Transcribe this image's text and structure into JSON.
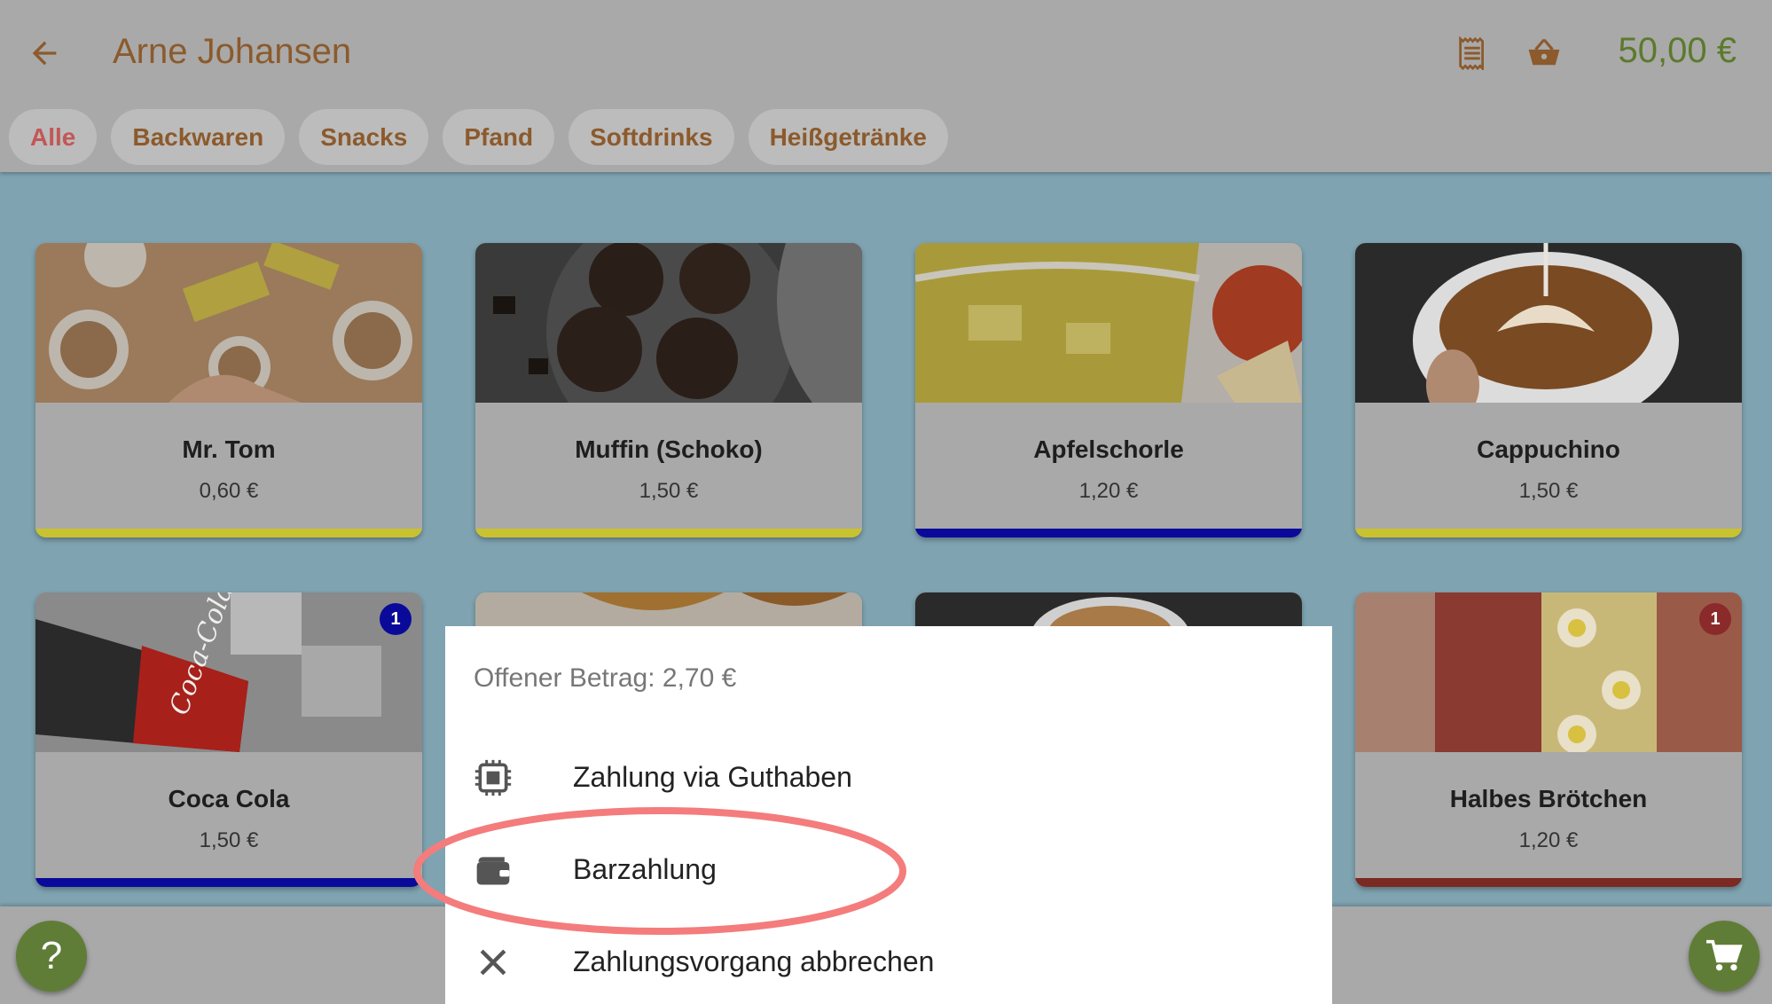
{
  "header": {
    "title": "Arne Johansen",
    "total": "50,00 €",
    "icons": {
      "back": "arrow-left-icon",
      "receipt": "receipt-icon",
      "basket": "basket-icon"
    }
  },
  "tabs": [
    {
      "label": "Alle",
      "active": true
    },
    {
      "label": "Backwaren",
      "active": false
    },
    {
      "label": "Snacks",
      "active": false
    },
    {
      "label": "Pfand",
      "active": false
    },
    {
      "label": "Softdrinks",
      "active": false
    },
    {
      "label": "Heißgetränke",
      "active": false
    }
  ],
  "products": [
    {
      "name": "Mr. Tom",
      "price": "0,60 €",
      "stripe_color": "#c9c230",
      "badge": null
    },
    {
      "name": "Muffin (Schoko)",
      "price": "1,50 €",
      "stripe_color": "#c9c230",
      "badge": null
    },
    {
      "name": "Apfelschorle",
      "price": "1,20 €",
      "stripe_color": "#0a0a9a",
      "badge": null
    },
    {
      "name": "Cappuchino",
      "price": "1,50 €",
      "stripe_color": "#c9c230",
      "badge": null
    },
    {
      "name": "Coca Cola",
      "price": "1,50 €",
      "stripe_color": "#0a0a9a",
      "badge": "1",
      "badge_color": "#0a0a9a"
    },
    {
      "name": "",
      "price": "",
      "stripe_color": "#c9c230",
      "badge": null
    },
    {
      "name": "",
      "price": "",
      "stripe_color": "#0a0a9a",
      "badge": null
    },
    {
      "name": "Halbes Brötchen",
      "price": "1,20 €",
      "stripe_color": "#7a2a22",
      "badge": "1",
      "badge_color": "#8b2a2a"
    }
  ],
  "payment_sheet": {
    "open_amount": "Offener Betrag: 2,70 €",
    "options": [
      {
        "label": "Zahlung via Guthaben",
        "icon": "chip-icon"
      },
      {
        "label": "Barzahlung",
        "icon": "wallet-icon",
        "highlighted": true
      },
      {
        "label": "Zahlungsvorgang abbrechen",
        "icon": "close-icon"
      }
    ]
  },
  "fabs": {
    "help": "?",
    "help_icon": "help-icon",
    "cart_icon": "cart-icon"
  },
  "colors": {
    "accent_green": "#5f7d36",
    "brown": "#8c5a2c",
    "active_tab": "#c45656",
    "highlight_ring": "#f47c7c"
  }
}
